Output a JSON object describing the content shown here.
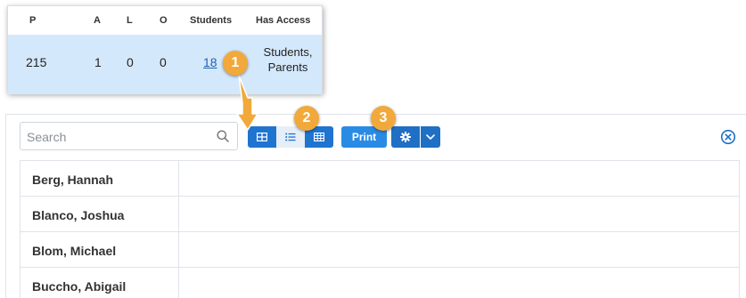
{
  "summary": {
    "headers": [
      "P",
      "A",
      "L",
      "O",
      "Students",
      "Has Access"
    ],
    "row": {
      "p": "215",
      "a": "1",
      "l": "0",
      "o": "0",
      "students": "18",
      "has_access_line1": "Students,",
      "has_access_line2": "Parents"
    }
  },
  "toolbar": {
    "search_placeholder": "Search",
    "print_label": "Print",
    "view_icons": [
      "grid-cards-icon",
      "list-icon",
      "table-icon"
    ],
    "settings_icon": "gear-icon",
    "dropdown_icon": "chevron-down-icon",
    "close_icon": "circle-x-icon"
  },
  "students": [
    {
      "name": "Berg, Hannah"
    },
    {
      "name": "Blanco, Joshua"
    },
    {
      "name": "Blom, Michael"
    },
    {
      "name": "Buccho, Abigail"
    }
  ],
  "callouts": [
    "1",
    "2",
    "3"
  ],
  "colors": {
    "accent": "#1f74d0",
    "row_highlight": "#d4e8fb",
    "callout": "#f2a93b",
    "link": "#1a64b5"
  }
}
